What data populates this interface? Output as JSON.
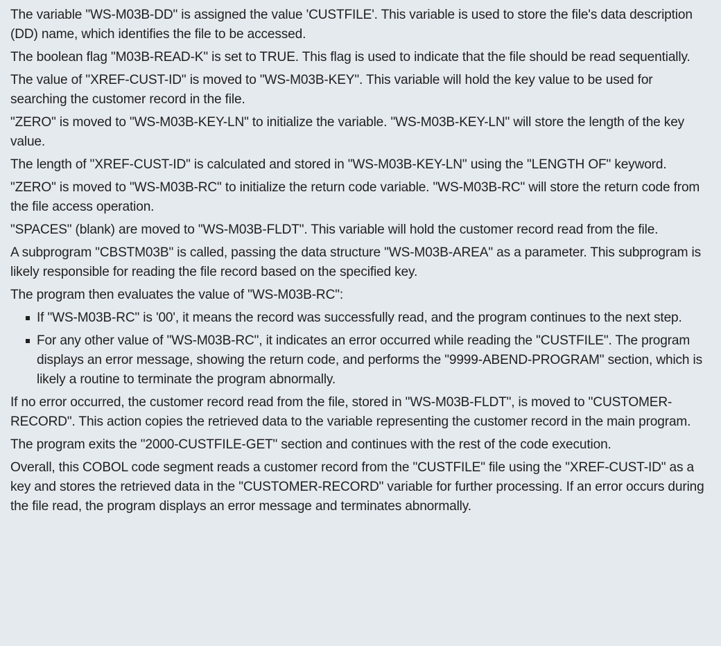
{
  "document": {
    "paragraphs_before": [
      "The variable \"WS-M03B-DD\" is assigned the value 'CUSTFILE'. This variable is used to store the file's data description (DD) name, which identifies the file to be accessed.",
      "The boolean flag \"M03B-READ-K\" is set to TRUE. This flag is used to indicate that the file should be read sequentially.",
      "The value of \"XREF-CUST-ID\" is moved to \"WS-M03B-KEY\". This variable will hold the key value to be used for searching the customer record in the file.",
      "\"ZERO\" is moved to \"WS-M03B-KEY-LN\" to initialize the variable. \"WS-M03B-KEY-LN\" will store the length of the key value.",
      "The length of \"XREF-CUST-ID\" is calculated and stored in \"WS-M03B-KEY-LN\" using the \"LENGTH OF\" keyword.",
      "\"ZERO\" is moved to \"WS-M03B-RC\" to initialize the return code variable. \"WS-M03B-RC\" will store the return code from the file access operation.",
      "\"SPACES\" (blank) are moved to \"WS-M03B-FLDT\". This variable will hold the customer record read from the file.",
      "A subprogram \"CBSTM03B\" is called, passing the data structure \"WS-M03B-AREA\" as a parameter. This subprogram is likely responsible for reading the file record based on the specified key.",
      "The program then evaluates the value of \"WS-M03B-RC\":"
    ],
    "bullets": [
      "If \"WS-M03B-RC\" is '00', it means the record was successfully read, and the program continues to the next step.",
      "For any other value of \"WS-M03B-RC\", it indicates an error occurred while reading the \"CUSTFILE\". The program displays an error message, showing the return code, and performs the \"9999-ABEND-PROGRAM\" section, which is likely a routine to terminate the program abnormally."
    ],
    "paragraphs_after": [
      "If no error occurred, the customer record read from the file, stored in \"WS-M03B-FLDT\", is moved to \"CUSTOMER-RECORD\". This action copies the retrieved data to the variable representing the customer record in the main program.",
      "The program exits the \"2000-CUSTFILE-GET\" section and continues with the rest of the code execution.",
      "Overall, this COBOL code segment reads a customer record from the \"CUSTFILE\" file using the \"XREF-CUST-ID\" as a key and stores the retrieved data in the \"CUSTOMER-RECORD\" variable for further processing. If an error occurs during the file read, the program displays an error message and terminates abnormally."
    ]
  },
  "colors": {
    "background": "#e5eaef",
    "text": "#1f1f1f"
  }
}
